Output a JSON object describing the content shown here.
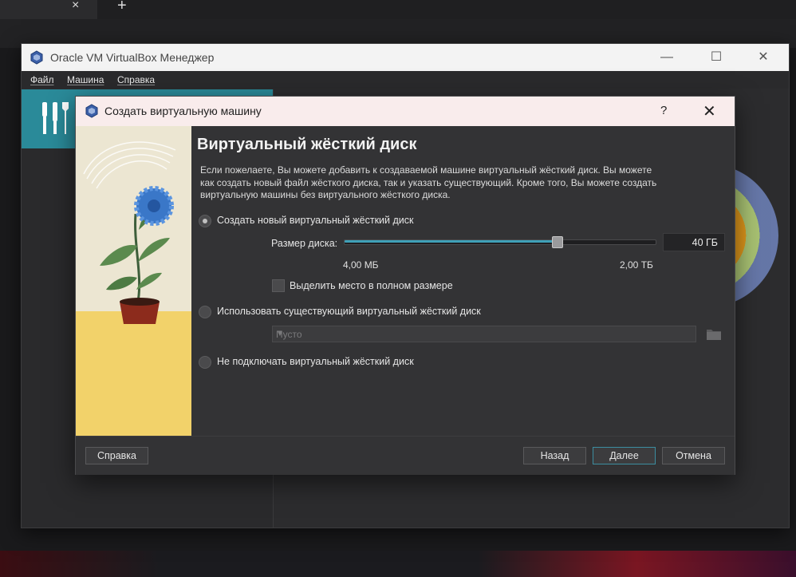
{
  "background": {
    "tab_close": "×",
    "tab_new": "+"
  },
  "main_window": {
    "title": "Oracle VM VirtualBox Менеджер",
    "menu": {
      "file": "Файл",
      "machine": "Машина",
      "help": "Справка"
    }
  },
  "dialog": {
    "title": "Создать виртуальную машину",
    "help_glyph": "?",
    "close_glyph": "✕",
    "heading": "Виртуальный жёсткий диск",
    "description": "Если пожелаете, Вы можете добавить к создаваемой машине виртуальный жёсткий диск. Вы можете как создать новый файл жёсткого диска, так и указать существующий. Кроме того, Вы можете создать виртуальную машины без виртуального жёсткого диска.",
    "option_new": {
      "label": "Создать новый виртуальный жёсткий диск",
      "selected": true
    },
    "disk_size": {
      "label": "Размер диска:",
      "value": "40 ГБ",
      "min_label": "4,00 МБ",
      "max_label": "2,00 ТБ",
      "slider_fraction": 0.69
    },
    "preallocate": {
      "label": "Выделить место в полном размере",
      "checked": false
    },
    "option_existing": {
      "label": "Использовать существующий виртуальный жёсткий диск",
      "selected": false
    },
    "existing_select": {
      "value": "Пусто"
    },
    "option_none": {
      "label": "Не подключать виртуальный жёсткий диск",
      "selected": false
    },
    "buttons": {
      "help": "Справка",
      "back": "Назад",
      "next": "Далее",
      "cancel": "Отмена"
    }
  },
  "colors": {
    "accent": "#2a8a99",
    "slider_fill": "#3fa0b8",
    "dialog_titlebar": "#f9ecec"
  }
}
